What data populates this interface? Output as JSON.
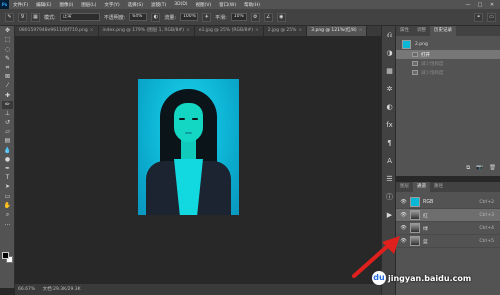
{
  "app": {
    "logo": "Ps"
  },
  "menu": [
    "文件(F)",
    "编辑(E)",
    "图像(I)",
    "图层(L)",
    "文字(Y)",
    "选择(S)",
    "滤镜(T)",
    "3D(D)",
    "视图(V)",
    "窗口(W)",
    "帮助(H)"
  ],
  "window_controls": [
    "—",
    "□",
    "✕"
  ],
  "options": {
    "brush_size": "9",
    "mode_label": "模式:",
    "mode_value": "正常",
    "opacity_label": "不透明度:",
    "opacity_value": "64%",
    "flow_label": "流量:",
    "flow_value": "100%",
    "smooth_label": "平滑:",
    "smooth_value": "10%"
  },
  "tabs": [
    {
      "label": "0801597948e961100f710.png",
      "active": false
    },
    {
      "label": "index.png @ 179% (图层 1, RGB/8#)",
      "active": false
    },
    {
      "label": "e1.jpg @ 25% (RGB/8#)",
      "active": false
    },
    {
      "label": "2.jpg @ 25%",
      "active": false
    },
    {
      "label": "3.png @ 121%(红/8)",
      "active": true
    }
  ],
  "status": {
    "left": "66.67%",
    "doc": "文档:29.3K/29.3K"
  },
  "history": {
    "tabs": [
      "属性",
      "调整",
      "历史记录"
    ],
    "snapshot": "2.png",
    "steps": [
      {
        "label": "打开",
        "state": "current"
      },
      {
        "label": "减少饱和度",
        "state": "dim"
      },
      {
        "label": "减少饱和度",
        "state": "dim"
      }
    ]
  },
  "channels": {
    "tabs": [
      "图层",
      "通道",
      "路径"
    ],
    "rows": [
      {
        "name": "RGB",
        "shortcut": "Ctrl+2",
        "thumb": "rgb",
        "selected": false
      },
      {
        "name": "红",
        "shortcut": "Ctrl+3",
        "thumb": "gray",
        "selected": true
      },
      {
        "name": "绿",
        "shortcut": "Ctrl+4",
        "thumb": "gray",
        "selected": false
      },
      {
        "name": "蓝",
        "shortcut": "Ctrl+5",
        "thumb": "gray",
        "selected": false
      }
    ]
  },
  "watermark": {
    "logo": "du",
    "text": "jingyan.baidu.com"
  },
  "colors": {
    "accent_arrow": "#e0201c",
    "photo_bg": "#0ab8d6"
  }
}
